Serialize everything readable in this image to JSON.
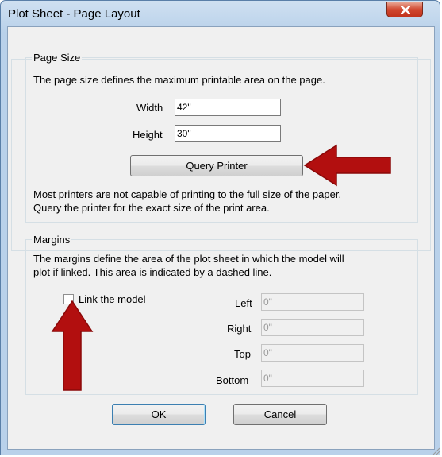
{
  "window": {
    "title": "Plot Sheet - Page Layout"
  },
  "page_size": {
    "group_label": "Page Size",
    "description": "The page size defines the maximum printable area on the page.",
    "width_label": "Width",
    "width_value": "42\"",
    "height_label": "Height",
    "height_value": "30\"",
    "query_button": "Query Printer",
    "note_line1": "Most printers are not capable of printing to the full size of the paper.",
    "note_line2": "Query the printer for the exact size of the print area."
  },
  "margins": {
    "group_label": "Margins",
    "description_line1": "The margins define the area of the plot sheet in which the model will",
    "description_line2": "plot if linked. This area is indicated by a dashed line.",
    "link_label": "Link the model",
    "link_checked": false,
    "left_label": "Left",
    "left_value": "0\"",
    "right_label": "Right",
    "right_value": "0\"",
    "top_label": "Top",
    "top_value": "0\"",
    "bottom_label": "Bottom",
    "bottom_value": "0\""
  },
  "buttons": {
    "ok": "OK",
    "cancel": "Cancel"
  },
  "colors": {
    "annotation_arrow": "#b20f0f",
    "close_button": "#c9402a"
  },
  "icons": {
    "close": "close-icon",
    "arrow_right": "red-arrow-right-icon",
    "arrow_up": "red-arrow-up-icon"
  }
}
